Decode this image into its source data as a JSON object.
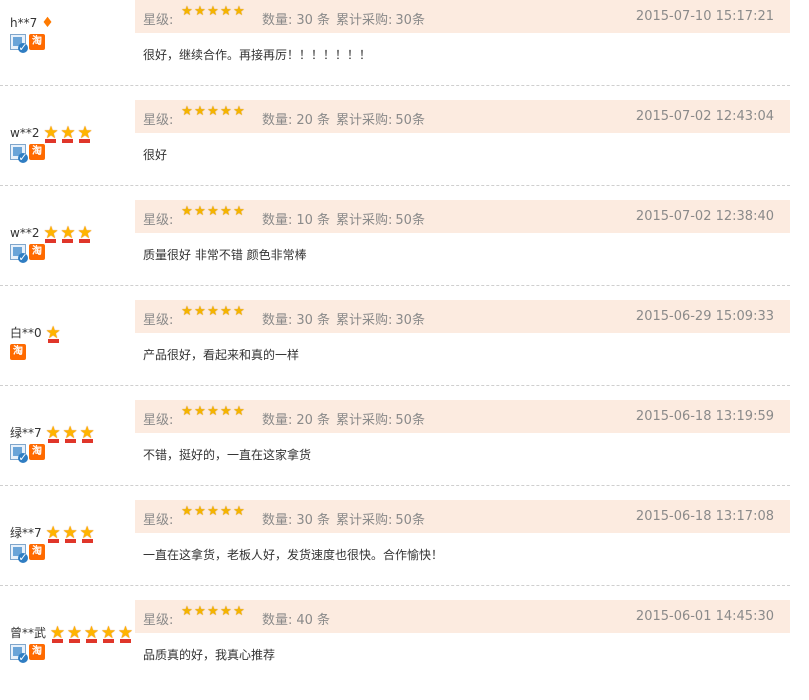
{
  "labels": {
    "star_label": "星级:",
    "qty_label": "数量:",
    "qty_unit": "条",
    "cum_label": "累计采购:",
    "cum_unit": "条"
  },
  "colors": {
    "meta_background": "#fcebe0",
    "star": "#f4b400",
    "tao_badge": "#ff6a00"
  },
  "reviews": [
    {
      "user": "h**7",
      "rank_icon": "diamond-icon",
      "rank_count": 1,
      "badges": [
        "verify-icon",
        "tao-icon"
      ],
      "tao_text": "淘",
      "stars": 5,
      "qty": "30",
      "cumulative": "30",
      "time": "2015-07-10 15:17:21",
      "content": "很好，继续合作。再接再厉！！！！！！！"
    },
    {
      "user": "w**2",
      "rank_icon": "star-medal-icon",
      "rank_count": 3,
      "badges": [
        "verify-icon",
        "tao-icon"
      ],
      "tao_text": "淘",
      "stars": 5,
      "qty": "20",
      "cumulative": "50",
      "time": "2015-07-02 12:43:04",
      "content": "很好"
    },
    {
      "user": "w**2",
      "rank_icon": "star-medal-icon",
      "rank_count": 3,
      "badges": [
        "verify-icon",
        "tao-icon"
      ],
      "tao_text": "淘",
      "stars": 5,
      "qty": "10",
      "cumulative": "50",
      "time": "2015-07-02 12:38:40",
      "content": "质量很好 非常不错 颜色非常棒"
    },
    {
      "user": "白**0",
      "rank_icon": "star-medal-icon",
      "rank_count": 1,
      "badges": [
        "tao-icon"
      ],
      "tao_text": "淘",
      "stars": 5,
      "qty": "30",
      "cumulative": "30",
      "time": "2015-06-29 15:09:33",
      "content": "产品很好，看起来和真的一样"
    },
    {
      "user": "绿**7",
      "rank_icon": "star-medal-icon",
      "rank_count": 3,
      "badges": [
        "verify-icon",
        "tao-icon"
      ],
      "tao_text": "淘",
      "stars": 5,
      "qty": "20",
      "cumulative": "50",
      "time": "2015-06-18 13:19:59",
      "content": "不错，挺好的，一直在这家拿货"
    },
    {
      "user": "绿**7",
      "rank_icon": "star-medal-icon",
      "rank_count": 3,
      "badges": [
        "verify-icon",
        "tao-icon"
      ],
      "tao_text": "淘",
      "stars": 5,
      "qty": "30",
      "cumulative": "50",
      "time": "2015-06-18 13:17:08",
      "content": "一直在这拿货，老板人好，发货速度也很快。合作愉快！"
    },
    {
      "user": "曾**武",
      "rank_icon": "star-medal-icon",
      "rank_count": 5,
      "badges": [
        "verify-icon",
        "tao-icon"
      ],
      "tao_text": "淘",
      "stars": 5,
      "qty": "40",
      "cumulative": null,
      "time": "2015-06-01 14:45:30",
      "content": "品质真的好，我真心推荐"
    }
  ]
}
